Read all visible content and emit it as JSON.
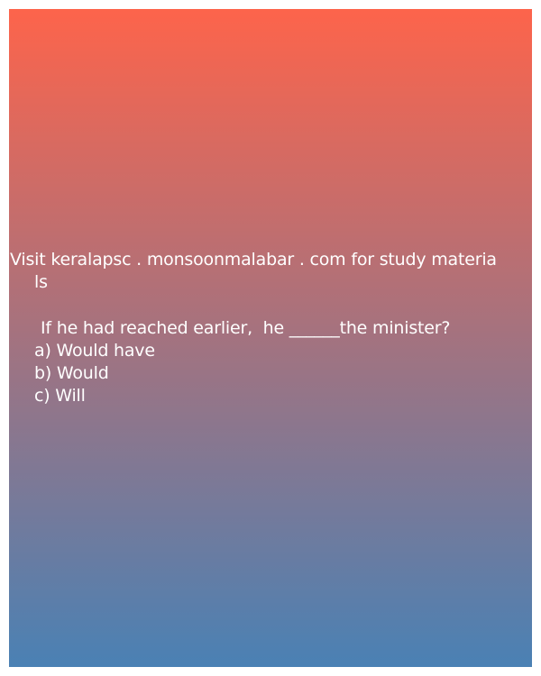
{
  "promo": {
    "line1": "Visit keralapsc . monsoonmalabar . com for study materia",
    "line2": "ls"
  },
  "question": {
    "text": "If he had reached earlier,  he ______the minister?",
    "options": [
      "a) Would have",
      "b) Would",
      "c) Will"
    ]
  },
  "colors": {
    "gradient_top": "#fd644b",
    "gradient_bottom": "#4a81b4",
    "text": "#ffffff"
  }
}
